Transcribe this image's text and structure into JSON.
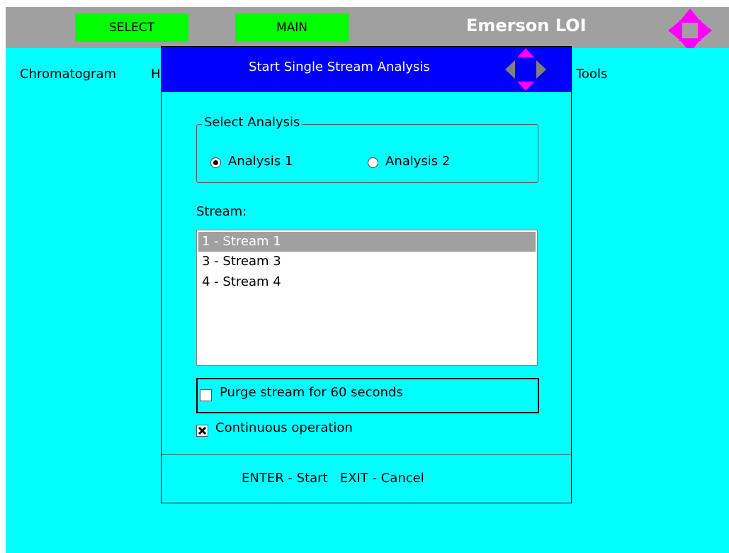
{
  "header": {
    "select_label": "SELECT",
    "main_label": "MAIN",
    "brand": "Emerson LOI",
    "nav_icon": "four-way-arrow-icon"
  },
  "menu": {
    "items": [
      "Chromatogram",
      "H",
      "Tools"
    ]
  },
  "dialog": {
    "title": "Start Single Stream Analysis",
    "title_icon": "four-way-arrow-icon",
    "group_label": "Select Analysis",
    "analysis_options": [
      {
        "label": "Analysis 1",
        "selected": true
      },
      {
        "label": "Analysis 2",
        "selected": false
      }
    ],
    "stream_label": "Stream:",
    "streams": [
      {
        "label": "1 - Stream 1",
        "selected": true
      },
      {
        "label": "3 - Stream 3",
        "selected": false
      },
      {
        "label": "4 - Stream 4",
        "selected": false
      }
    ],
    "purge": {
      "label": "Purge stream for 60 seconds",
      "checked": false
    },
    "continuous": {
      "label": "Continuous operation",
      "checked": true
    },
    "footer": "ENTER - Start   EXIT - Cancel"
  },
  "colors": {
    "background": "#00ffff",
    "topbar": "#a0a0a0",
    "green_button": "#00ff00",
    "title_bar": "#0000ff",
    "magenta": "#ff00ff",
    "grey_arrow": "#808080"
  }
}
